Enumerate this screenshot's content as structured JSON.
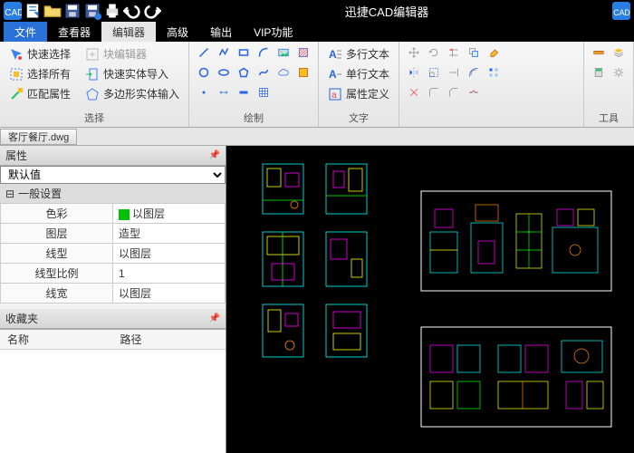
{
  "app": {
    "title": "迅捷CAD编辑器"
  },
  "menu": {
    "items": [
      "文件",
      "查看器",
      "编辑器",
      "高级",
      "输出",
      "VIP功能"
    ],
    "active_blue": "文件",
    "active_gray": "编辑器"
  },
  "ribbon": {
    "groups": [
      {
        "label": "选择",
        "items": [
          {
            "icon": "quicksel",
            "text": "快速选择"
          },
          {
            "icon": "selall",
            "text": "选择所有"
          },
          {
            "icon": "matchprop",
            "text": "匹配属性"
          },
          {
            "icon": "blockedit",
            "text": "块编辑器",
            "disabled": true
          },
          {
            "icon": "importent",
            "text": "快速实体导入"
          },
          {
            "icon": "polyinput",
            "text": "多边形实体输入"
          }
        ]
      },
      {
        "label": "绘制"
      },
      {
        "label": "文字",
        "items": [
          {
            "icon": "mtext",
            "text": "多行文本"
          },
          {
            "icon": "stext",
            "text": "单行文本"
          },
          {
            "icon": "attdef",
            "text": "属性定义"
          }
        ]
      },
      {
        "label": "",
        "spacer": true
      },
      {
        "label": "工具"
      }
    ]
  },
  "doc": {
    "name": "客厅餐厅.dwg"
  },
  "props": {
    "panel_title": "属性",
    "default_combo": "默认值",
    "section": "一般设置",
    "rows": [
      {
        "k": "色彩",
        "v": "以图层",
        "swatch": "#00c200"
      },
      {
        "k": "图层",
        "v": "造型"
      },
      {
        "k": "线型",
        "v": "以图层"
      },
      {
        "k": "线型比例",
        "v": "1"
      },
      {
        "k": "线宽",
        "v": "以图层"
      }
    ]
  },
  "favorites": {
    "title": "收藏夹",
    "col1": "名称",
    "col2": "路径"
  }
}
